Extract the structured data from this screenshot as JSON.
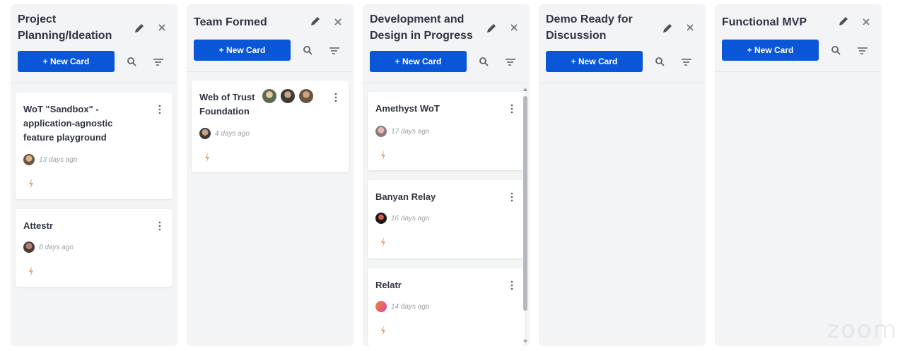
{
  "columns": [
    {
      "title": "Project Planning/Ideation",
      "new_card_label": "+ New Card",
      "cards": [
        {
          "title": "WoT \"Sandbox\" - application-agnostic feature playground",
          "time": "13 days ago"
        },
        {
          "title": "Attestr",
          "time": "8 days ago"
        }
      ]
    },
    {
      "title": "Team Formed",
      "new_card_label": "+ New Card",
      "cards": [
        {
          "title": "Web of Trust Foundation",
          "time": "4 days ago"
        }
      ]
    },
    {
      "title": "Development and Design in Progress",
      "new_card_label": "+ New Card",
      "cards": [
        {
          "title": "Amethyst WoT",
          "time": "17 days ago"
        },
        {
          "title": "Banyan Relay",
          "time": "16 days ago"
        },
        {
          "title": "Relatr",
          "time": "14 days ago"
        }
      ]
    },
    {
      "title": "Demo Ready for Discussion",
      "new_card_label": "+ New Card",
      "cards": []
    },
    {
      "title": "Functional MVP",
      "new_card_label": "+ New Card",
      "cards": []
    }
  ],
  "watermark": "zoom",
  "colors": {
    "accent": "#0a56d8",
    "bolt": "#f0a070",
    "column_bg": "#f3f4f6"
  },
  "icons": [
    "edit-icon",
    "close-icon",
    "search-icon",
    "sort-icon",
    "more-vertical-icon",
    "lightning-icon",
    "avatar"
  ]
}
